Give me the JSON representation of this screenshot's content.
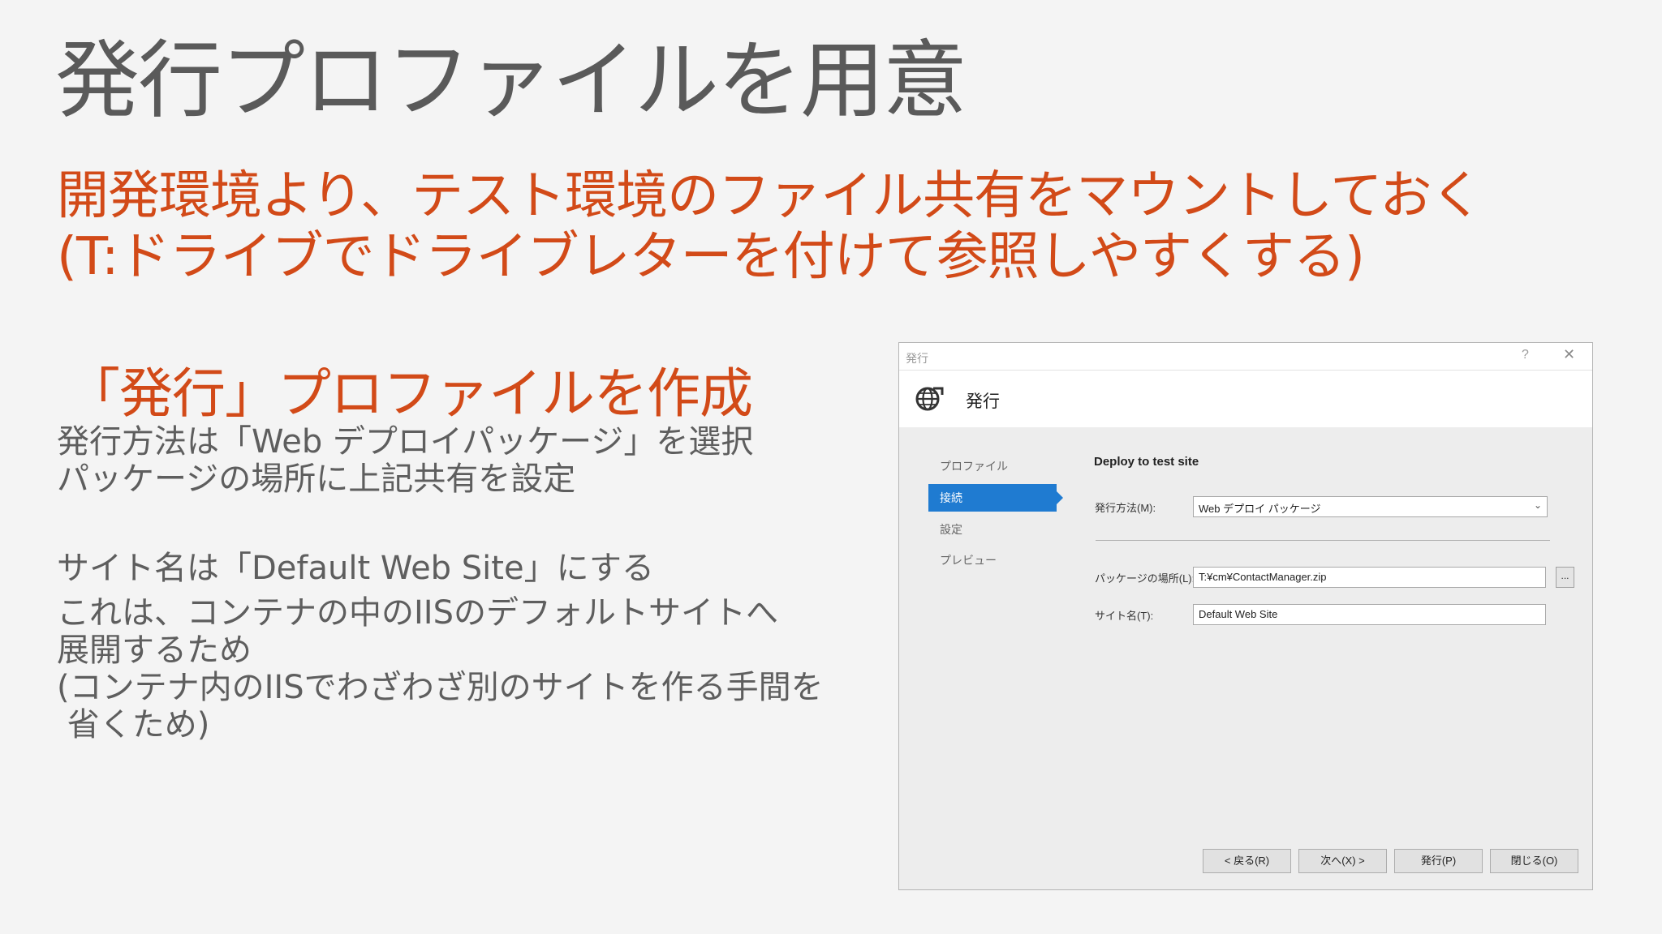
{
  "slide": {
    "title": "発行プロファイルを用意",
    "subtitle_line1": "開発環境より、テスト環境のファイル共有をマウントしておく",
    "subtitle_line2": "(T:ドライブでドライブレターを付けて参照しやすくする)",
    "section_heading": "「発行」プロファイルを作成",
    "body1_line1": "発行方法は「Web デプロイパッケージ」を選択",
    "body1_line2": "パッケージの場所に上記共有を設定",
    "body2": "サイト名は「Default Web Site」にする",
    "body3_line1": "これは、コンテナの中のIISのデフォルトサイトへ",
    "body3_line2": "展開するため",
    "body4_line1": "(コンテナ内のIISでわざわざ別のサイトを作る手間を",
    "body4_line2": " 省くため)"
  },
  "dialog": {
    "window_title": "発行",
    "help_glyph": "?",
    "close_glyph": "✕",
    "header_title": "発行",
    "nav": {
      "profile": "プロファイル",
      "connection": "接続",
      "settings": "設定",
      "preview": "プレビュー"
    },
    "section_title": "Deploy to test site",
    "method_label": "発行方法(M):",
    "method_value": "Web デプロイ パッケージ",
    "package_location_label": "パッケージの場所(L):",
    "package_location_value": "T:¥cm¥ContactManager.zip",
    "browse_label": "...",
    "site_name_label": "サイト名(T):",
    "site_name_value": "Default Web Site",
    "buttons": {
      "back": "< 戻る(R)",
      "next": "次へ(X) >",
      "publish": "発行(P)",
      "close": "閉じる(O)"
    }
  },
  "colors": {
    "accent_orange": "#d24a18",
    "selected_nav": "#1f7bd1",
    "title_gray": "#5a5a5a"
  },
  "icons": [
    "globe-icon",
    "help-icon",
    "close-icon",
    "chevron-down-icon"
  ]
}
